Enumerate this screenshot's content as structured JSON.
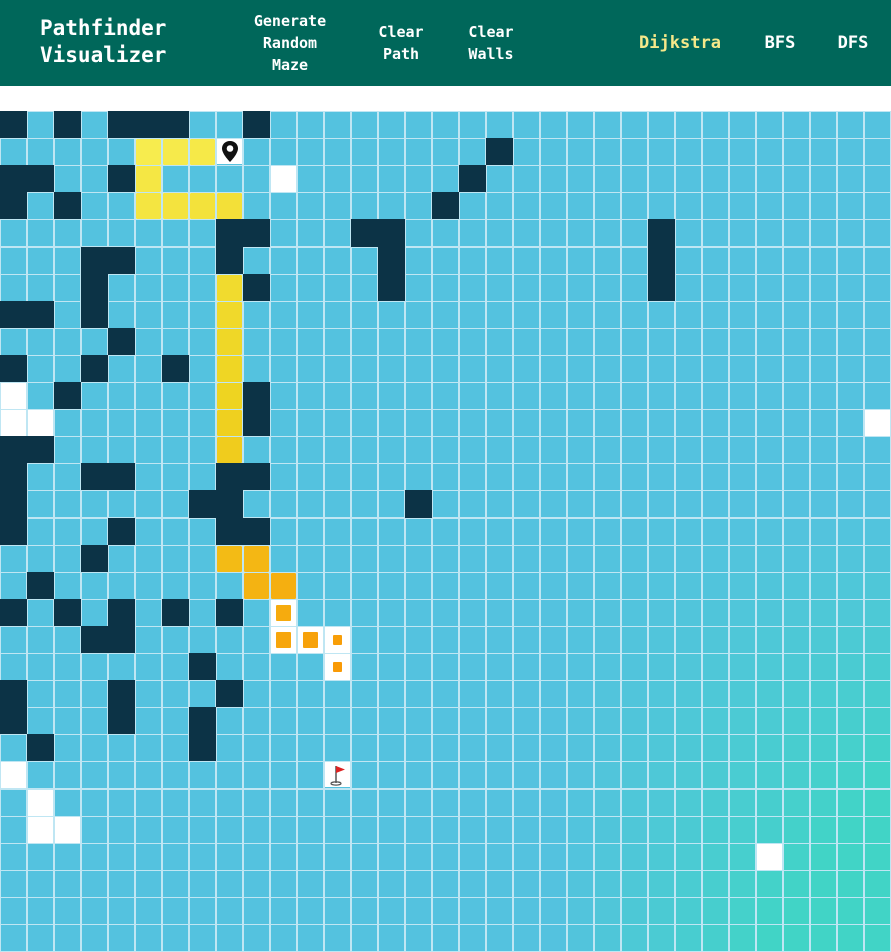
{
  "navbar": {
    "brand": "Pathfinder\nVisualizer",
    "generate_maze": "Generate\nRandom\nMaze",
    "clear_path": "Clear\nPath",
    "clear_walls": "Clear\nWalls",
    "algorithms": [
      "Dijkstra",
      "BFS",
      "DFS"
    ],
    "active_algorithm": "Dijkstra"
  },
  "grid": {
    "rows": 31,
    "cols": 33,
    "start_node": [
      1,
      8
    ],
    "finish_node": [
      24,
      12
    ],
    "icons": {
      "start": "map-pin-icon",
      "finish": "flag-icon"
    },
    "colors": {
      "visited_near": "#54c2df",
      "visited_far": "#41d4c6",
      "wall": "#0c3346",
      "unvisited": "#ffffff",
      "path_start": "#f7ec4e",
      "path_mid": "#eed421",
      "path_end": "#f99a06",
      "navbar": "#00675a",
      "active_nav": "#f5e88a"
    },
    "map": [
      "#.#.###..#.......................#..",
      "..................#.................",
      "##..#............#..................",
      "#.#.............#...................",
      "........##...##.........#...........",
      "...##...#.....#.........#...........",
      "...#.....#....#.........#...........",
      "##.#................................",
      "....#...............................",
      "#..#..#.............................",
      "..#......#..........................",
      ".........#..........................",
      "##...................................",
      "#..##...##.........................",
      "#......##......#...................",
      "#...#...##.........................",
      "...#.......................",
      ".#.......................",
      "#.#.#.#.#....................",
      "...##.......................",
      ".......#....................",
      "#...#...#....................",
      "#...#..#......................",
      ".#.....#......................",
      "...........................",
      "..................................",
      "..................................",
      "..................................",
      "..................................",
      "..................................",
      ".................................."
    ]
  }
}
